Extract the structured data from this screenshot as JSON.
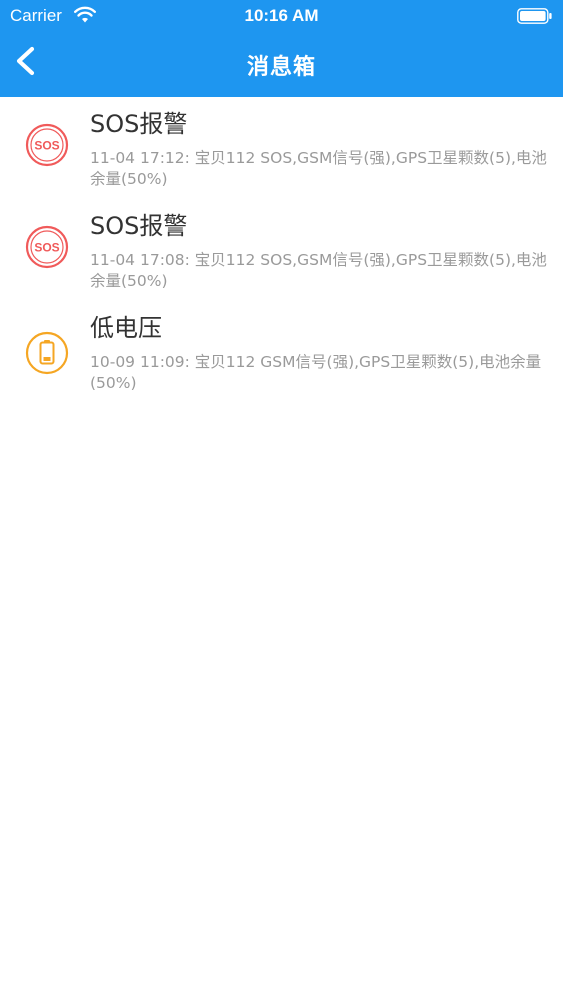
{
  "status_bar": {
    "carrier": "Carrier",
    "time": "10:16 AM"
  },
  "nav": {
    "title": "消息箱"
  },
  "colors": {
    "header": "#1e96f0",
    "sos_red": "#f05a5a",
    "low_battery_orange": "#f5a623",
    "title_text": "#333333",
    "desc_text": "#9a9a9a"
  },
  "messages": [
    {
      "icon": "sos-icon",
      "title": "SOS报警",
      "description": "11-04 17:12: 宝贝112 SOS,GSM信号(强),GPS卫星颗数(5),电池余量(50%)"
    },
    {
      "icon": "sos-icon",
      "title": "SOS报警",
      "description": "11-04 17:08: 宝贝112 SOS,GSM信号(强),GPS卫星颗数(5),电池余量(50%)"
    },
    {
      "icon": "low-battery-icon",
      "title": "低电压",
      "description": "10-09 11:09: 宝贝112 GSM信号(强),GPS卫星颗数(5),电池余量(50%)"
    }
  ]
}
